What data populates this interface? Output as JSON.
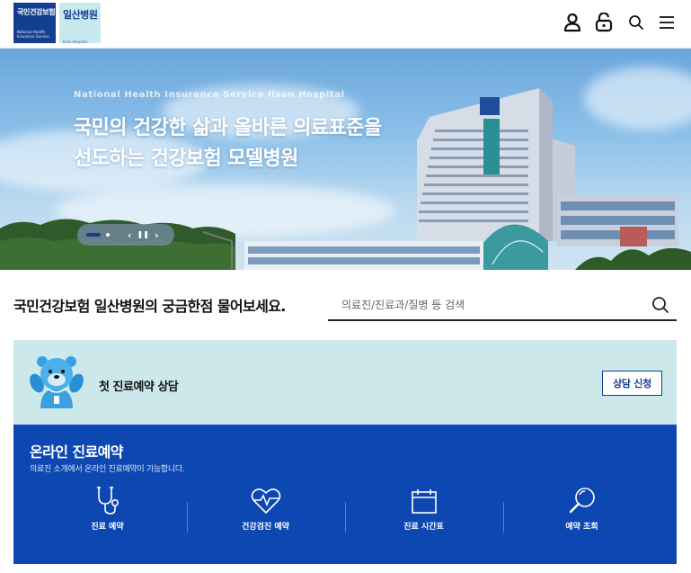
{
  "header": {
    "logo_primary_text": "국민건강보험",
    "logo_primary_sub": "National Health Insurance Service",
    "logo_secondary_text": "일산병원",
    "logo_secondary_sub": "Ilsan Hospital",
    "icons": [
      "user-icon",
      "lock-icon",
      "search-icon",
      "menu-icon"
    ]
  },
  "hero": {
    "subtitle": "National Health Insurance Service Ilsan Hospital",
    "title_line1": "국민의 건강한 삶과 올바른 의료표준을",
    "title_line2": "선도하는 건강보험 모델병원",
    "controls": {
      "prev": "‹",
      "pause": "❚❚",
      "next": "›"
    },
    "building_sign": "일산병원"
  },
  "search": {
    "title": "국민건강보험 일산병원의 궁금한점 물어보세요.",
    "placeholder": "의료진/진료과/질병 등 검색"
  },
  "consult": {
    "label": "첫 진료예약 상담",
    "button": "상담 신청"
  },
  "reservation": {
    "title": "온라인 진료예약",
    "description": "의료진 소개에서 온라인 진료예약이 가능합니다.",
    "items": [
      {
        "label": "진료 예약",
        "icon": "stethoscope-icon"
      },
      {
        "label": "건강검진 예약",
        "icon": "heart-pulse-icon"
      },
      {
        "label": "진료 시간표",
        "icon": "calendar-icon"
      },
      {
        "label": "예약 조회",
        "icon": "magnifier-icon"
      }
    ]
  },
  "colors": {
    "brand_navy": "#143e8f",
    "brand_blue": "#0d47b1",
    "mint": "#cde8eb"
  }
}
